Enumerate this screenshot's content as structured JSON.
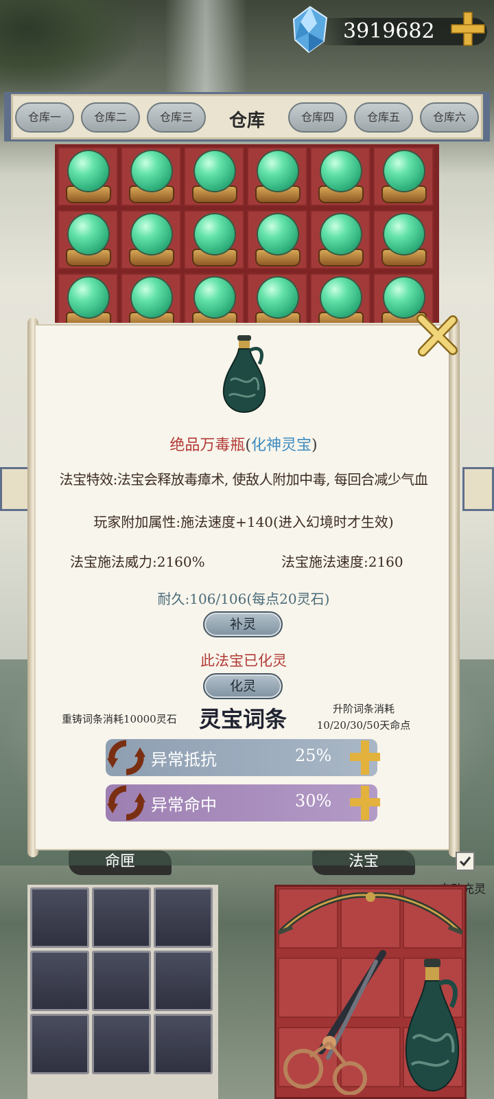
{
  "currency": {
    "amount": "3919682",
    "icon": "blue-gem-icon",
    "add_icon": "gold-plus-icon"
  },
  "warehouse": {
    "title": "仓库",
    "tabs": [
      "仓库一",
      "仓库二",
      "仓库三",
      "仓库四",
      "仓库五",
      "仓库六"
    ],
    "slot_item": "green-spirit-orb-icon",
    "visible_rows": 3,
    "columns": 6
  },
  "popup": {
    "item_icon": "poison-vase-icon",
    "name_prefix": "绝品万毒瓶",
    "paren_open": "(",
    "grade": "化神灵宝",
    "paren_close": ")",
    "effect": "法宝特效:法宝会释放毒瘴术, 使敌人附加中毒, 每回合减少气血",
    "player_bonus": "玩家附加属性:施法速度+140(进入幻境时才生效)",
    "power": "法宝施法威力:2160%",
    "speed": "法宝施法速度:2160",
    "durability": "耐久:106/106(每点20灵石)",
    "refill_label": "补灵",
    "spirit_status": "此法宝已化灵",
    "spirit_label": "化灵",
    "recast_cost": "重铸词条消耗10000灵石",
    "affix_title": "灵宝词条",
    "upgrade_cost_line1": "升阶词条消耗",
    "upgrade_cost_line2": "10/20/30/50天命点",
    "affixes": [
      {
        "label": "异常抵抗",
        "value": "25%"
      },
      {
        "label": "异常命中",
        "value": "30%"
      }
    ],
    "close_icon": "gold-x-close-icon"
  },
  "bottom": {
    "fate_title": "命匣",
    "treasure_title": "法宝",
    "auto_label": "自动充灵",
    "auto_checked": true,
    "fate_slots": 9,
    "treasure_items": [
      "bow-icon",
      "scissors-icon",
      "poison-vase-icon"
    ]
  },
  "colors": {
    "storage_red": "#a33a3a",
    "name_red": "#b23a36",
    "grade_blue": "#3d8bbf",
    "affix1": "#8e9fb2",
    "affix2": "#9d7fb2",
    "gold": "#e3b23c"
  }
}
